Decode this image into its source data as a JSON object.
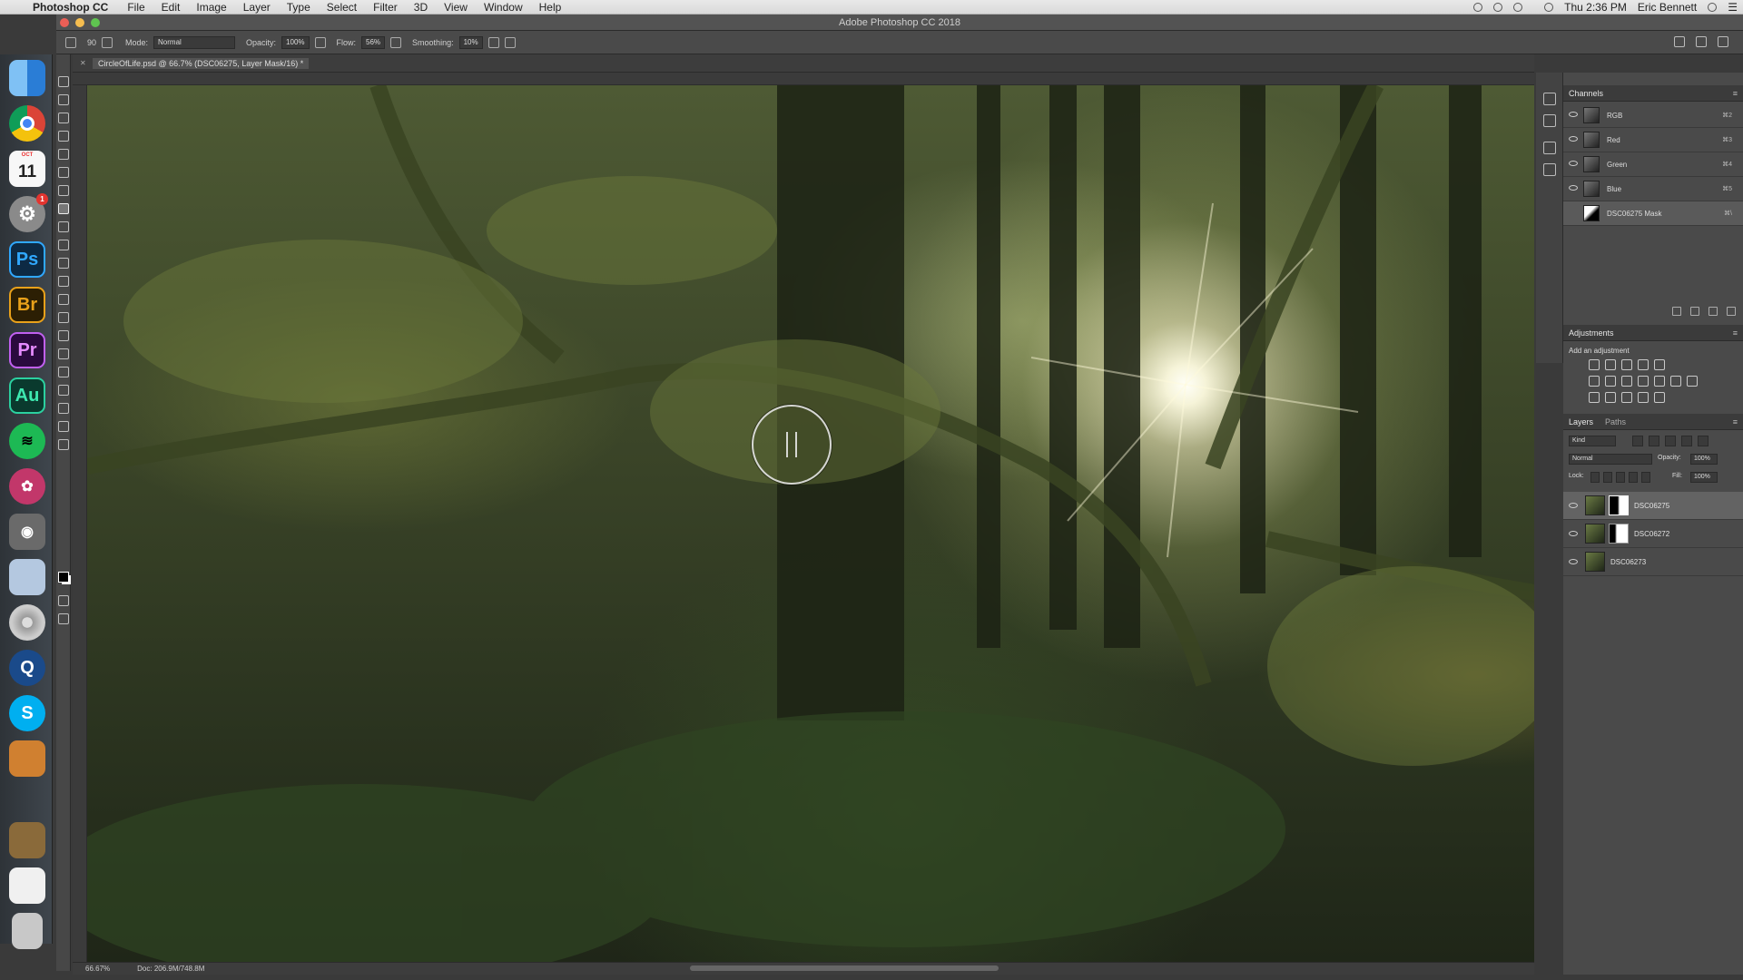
{
  "mac_menubar": {
    "app_name": "Photoshop CC",
    "menus": [
      "File",
      "Edit",
      "Image",
      "Layer",
      "Type",
      "Select",
      "Filter",
      "3D",
      "View",
      "Window",
      "Help"
    ],
    "clock": "Thu 2:36 PM",
    "user": "Eric Bennett",
    "status_icons": [
      "record-icon",
      "timemachine-icon",
      "wifi-icon",
      "airplay-icon",
      "search-icon",
      "notification-icon"
    ]
  },
  "window": {
    "title": "Adobe Photoshop CC 2018"
  },
  "options_bar": {
    "size": "90",
    "mode_label": "Mode:",
    "mode_value": "Normal",
    "opacity_label": "Opacity:",
    "opacity_value": "100%",
    "flow_label": "Flow:",
    "flow_value": "56%",
    "smoothing_label": "Smoothing:",
    "smoothing_value": "10%"
  },
  "dock": {
    "calendar_month": "OCT",
    "calendar_day": "11",
    "badge_count": "1",
    "apps": [
      {
        "name": "finder-icon",
        "label": "",
        "color": "#3b8fe0"
      },
      {
        "name": "chrome-icon",
        "label": "",
        "color": "#e9e9e9"
      },
      {
        "name": "calendar-icon",
        "label": "",
        "color": "#f5f5f5"
      },
      {
        "name": "system-prefs-icon",
        "label": "",
        "color": "#8c8c8c"
      },
      {
        "name": "photoshop-icon",
        "label": "Ps",
        "color": "#0d2a44"
      },
      {
        "name": "bridge-icon",
        "label": "Br",
        "color": "#3a2a06"
      },
      {
        "name": "premiere-icon",
        "label": "Pr",
        "color": "#2a0a3e"
      },
      {
        "name": "audition-icon",
        "label": "Au",
        "color": "#0a3a2e"
      },
      {
        "name": "spotify-icon",
        "label": "",
        "color": "#1db954"
      },
      {
        "name": "davinci-icon",
        "label": "",
        "color": "#c83a6a"
      },
      {
        "name": "screenshot-icon",
        "label": "",
        "color": "#6a6a6a"
      },
      {
        "name": "preview-icon",
        "label": "",
        "color": "#b4c8e0"
      },
      {
        "name": "dvd-icon",
        "label": "",
        "color": "#a0a0a0"
      },
      {
        "name": "quicktime-icon",
        "label": "",
        "color": "#1a4a8a"
      },
      {
        "name": "skype-icon",
        "label": "S",
        "color": "#00aff0"
      },
      {
        "name": "calculator-icon",
        "label": "",
        "color": "#d08030"
      },
      {
        "name": "folder-icon",
        "label": "",
        "color": "#8a6a3a"
      },
      {
        "name": "notes-icon",
        "label": "",
        "color": "#f0f0f0"
      },
      {
        "name": "trash-icon",
        "label": "",
        "color": "#c8c8c8"
      }
    ]
  },
  "document": {
    "tab_title": "CircleOfLife.psd @ 66.7% (DSC06275, Layer Mask/16) *",
    "zoom": "66.67%",
    "doc_size": "Doc: 206.9M/748.8M"
  },
  "channels_panel": {
    "title": "Channels",
    "channels": [
      {
        "name": "RGB",
        "shortcut": "⌘2"
      },
      {
        "name": "Red",
        "shortcut": "⌘3"
      },
      {
        "name": "Green",
        "shortcut": "⌘4"
      },
      {
        "name": "Blue",
        "shortcut": "⌘5"
      },
      {
        "name": "DSC06275 Mask",
        "shortcut": "⌘\\"
      }
    ]
  },
  "adjustments_panel": {
    "title": "Adjustments",
    "subtitle": "Add an adjustment"
  },
  "layers_panel": {
    "tab_layers": "Layers",
    "tab_paths": "Paths",
    "kind_label": "Kind",
    "blend_mode": "Normal",
    "opacity_label": "Opacity:",
    "opacity_value": "100%",
    "lock_label": "Lock:",
    "fill_label": "Fill:",
    "fill_value": "100%",
    "layers": [
      {
        "name": "DSC06275",
        "has_mask": true,
        "selected": true
      },
      {
        "name": "DSC06272",
        "has_mask": true,
        "selected": false
      },
      {
        "name": "DSC06273",
        "has_mask": false,
        "selected": false
      }
    ]
  }
}
